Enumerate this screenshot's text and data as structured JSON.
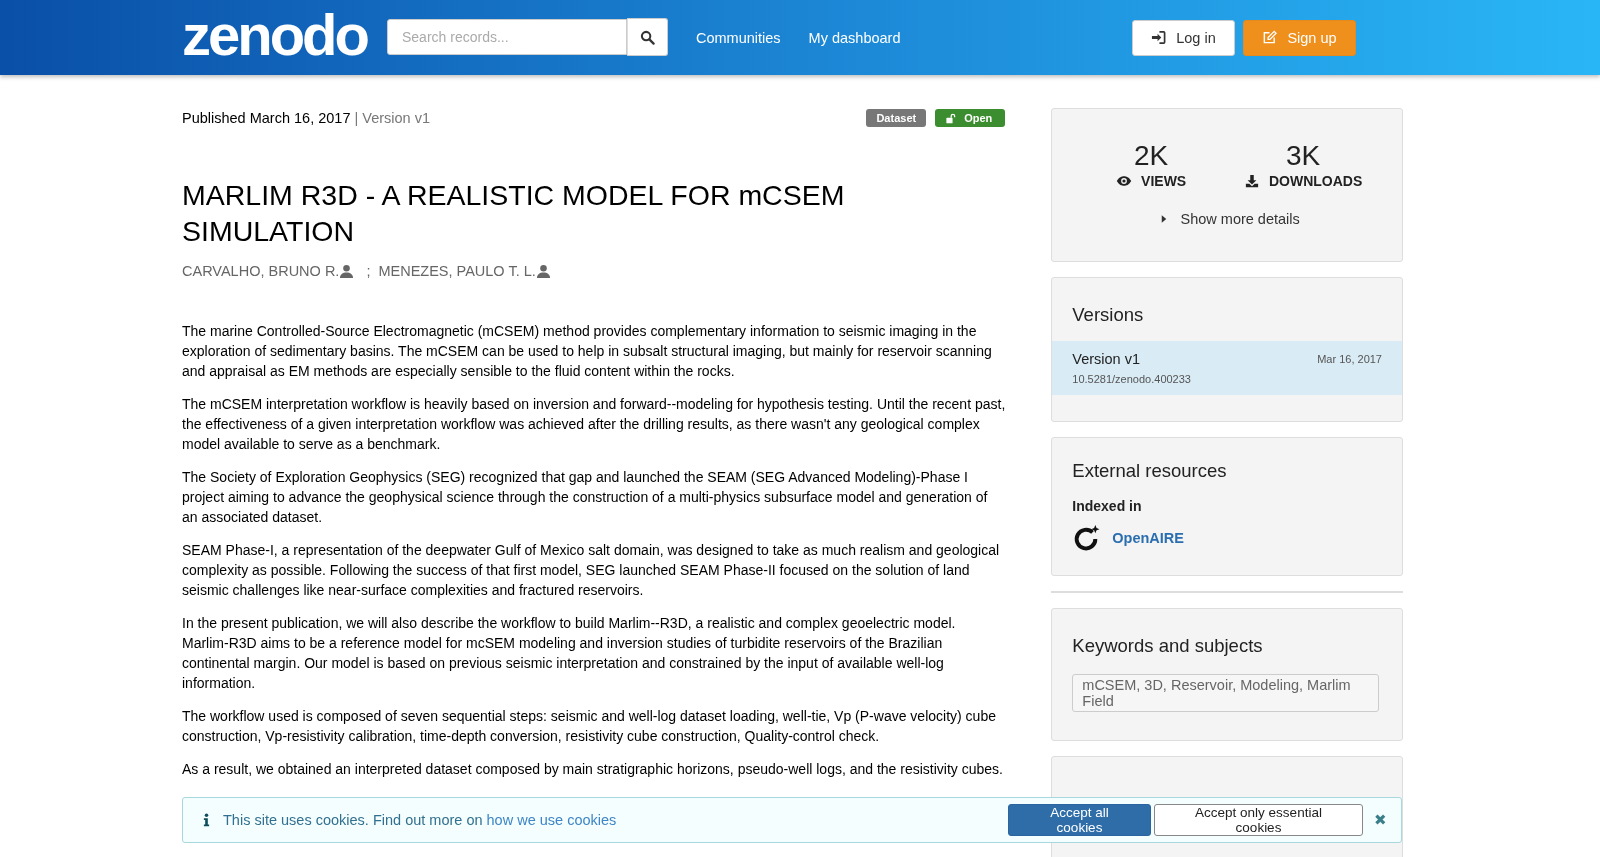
{
  "header": {
    "logo": "zenodo",
    "search": {
      "placeholder": "Search records..."
    },
    "nav": [
      "Communities",
      "My dashboard"
    ],
    "buttons": [
      {
        "label": "Log in",
        "kind": "login"
      },
      {
        "label": "Sign up",
        "kind": "signup"
      }
    ]
  },
  "record": {
    "published": "Published March 16, 2017",
    "version": "| Version v1",
    "badges": [
      {
        "label": "Dataset",
        "kind": "type"
      },
      {
        "label": "Open",
        "kind": "access"
      }
    ],
    "title": "MARLIM R3D - A REALISTIC MODEL FOR mCSEM SIMULATION",
    "creators": [
      "CARVALHO, BRUNO R.",
      "MENEZES, PAULO T. L."
    ],
    "creator_separator": ";",
    "description": [
      "The marine Controlled-Source Electromagnetic (mCSEM) method provides complementary information to seismic imaging in the exploration of sedimentary basins. The mCSEM can be used to help in subsalt structural imaging, but mainly for reservoir scanning and appraisal as EM methods are especially sensible to the fluid content within the rocks.",
      "The mCSEM interpretation workflow is heavily based on inversion and forward--modeling for hypothesis testing. Until the recent past, the effectiveness of a given interpretation workflow was achieved after the drilling results, as there wasn't any geological complex model available to serve as a benchmark.",
      "The Society of Exploration Geophysics (SEG) recognized that gap and launched the SEAM (SEG Advanced Modeling)-Phase I project aiming to advance the geophysical science through the construction of a multi-physics subsurface model and generation of an associated dataset.",
      "SEAM Phase-I,  a representation of the deepwater Gulf of Mexico salt domain, was designed to take as much realism and geological complexity as possible. Following the success of that first model, SEG launched SEAM Phase-II focused on the solution of land seismic challenges like near-surface complexities and fractured reservoirs.",
      "In the present publication, we will also describe the workflow to build Marlim--R3D, a realistic and complex geoelectric model.  Marlim-R3D aims to be a reference model for mcSEM modeling and inversion studies of turbidite reservoirs of the Brazilian continental margin. Our model is based on previous seismic interpretation and constrained by the input of available well-log information.",
      "The workflow used is composed of seven sequential steps: seismic and well-log dataset loading, well-tie, Vp (P-wave velocity) cube construction, Vp-resistivity calibration, time-depth conversion, resistivity cube construction, Quality-control check.",
      "As a result, we obtained an interpreted dataset composed by main stratigraphic horizons, pseudo-well logs, and the resistivity cubes."
    ]
  },
  "sidebar": {
    "stats": [
      {
        "value": "2K",
        "label": "VIEWS",
        "kind": "views"
      },
      {
        "value": "3K",
        "label": "DOWNLOADS",
        "kind": "downloads"
      }
    ],
    "show_more": "Show more details",
    "versions": {
      "title": "Versions",
      "items": [
        {
          "label": "Version v1",
          "date": "Mar 16, 2017",
          "doi": "10.5281/zenodo.400233",
          "selected": true
        }
      ]
    },
    "external": {
      "title": "External resources",
      "indexed_label": "Indexed in",
      "link": "OpenAIRE"
    },
    "keywords": {
      "title": "Keywords and subjects",
      "text": "mCSEM, 3D, Reservoir, Modeling, Marlim Field"
    }
  },
  "cookie_banner": {
    "text": "This site uses cookies. Find out more on",
    "link": "how we use cookies",
    "buttons": [
      {
        "label": "Accept all cookies",
        "kind": "primary"
      },
      {
        "label": "Accept only essential cookies",
        "kind": "secondary"
      }
    ],
    "close": "✖"
  }
}
